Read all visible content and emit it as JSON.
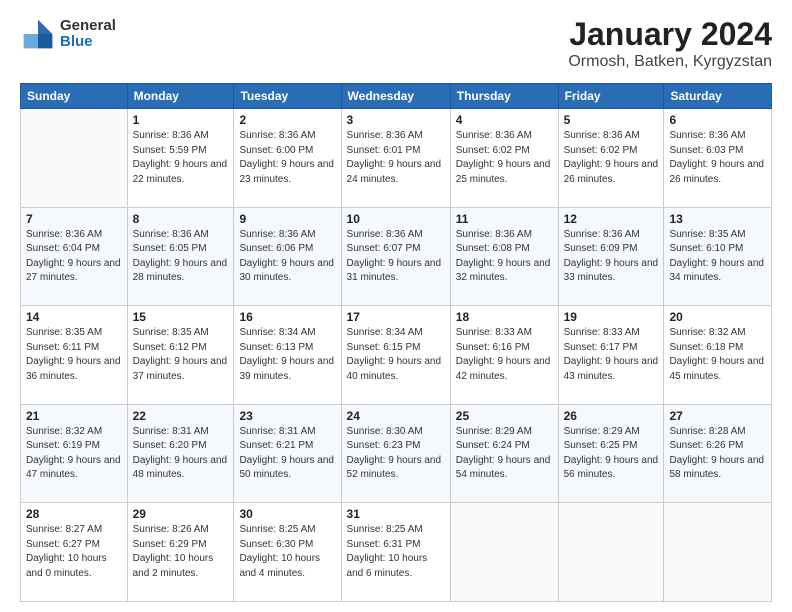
{
  "header": {
    "title": "January 2024",
    "location": "Ormosh, Batken, Kyrgyzstan",
    "logo_general": "General",
    "logo_blue": "Blue"
  },
  "days_of_week": [
    "Sunday",
    "Monday",
    "Tuesday",
    "Wednesday",
    "Thursday",
    "Friday",
    "Saturday"
  ],
  "weeks": [
    [
      {
        "day": "",
        "sunrise": "",
        "sunset": "",
        "daylight": "",
        "empty": true
      },
      {
        "day": "1",
        "sunrise": "Sunrise: 8:36 AM",
        "sunset": "Sunset: 5:59 PM",
        "daylight": "Daylight: 9 hours and 22 minutes."
      },
      {
        "day": "2",
        "sunrise": "Sunrise: 8:36 AM",
        "sunset": "Sunset: 6:00 PM",
        "daylight": "Daylight: 9 hours and 23 minutes."
      },
      {
        "day": "3",
        "sunrise": "Sunrise: 8:36 AM",
        "sunset": "Sunset: 6:01 PM",
        "daylight": "Daylight: 9 hours and 24 minutes."
      },
      {
        "day": "4",
        "sunrise": "Sunrise: 8:36 AM",
        "sunset": "Sunset: 6:02 PM",
        "daylight": "Daylight: 9 hours and 25 minutes."
      },
      {
        "day": "5",
        "sunrise": "Sunrise: 8:36 AM",
        "sunset": "Sunset: 6:02 PM",
        "daylight": "Daylight: 9 hours and 26 minutes."
      },
      {
        "day": "6",
        "sunrise": "Sunrise: 8:36 AM",
        "sunset": "Sunset: 6:03 PM",
        "daylight": "Daylight: 9 hours and 26 minutes."
      }
    ],
    [
      {
        "day": "7",
        "sunrise": "Sunrise: 8:36 AM",
        "sunset": "Sunset: 6:04 PM",
        "daylight": "Daylight: 9 hours and 27 minutes."
      },
      {
        "day": "8",
        "sunrise": "Sunrise: 8:36 AM",
        "sunset": "Sunset: 6:05 PM",
        "daylight": "Daylight: 9 hours and 28 minutes."
      },
      {
        "day": "9",
        "sunrise": "Sunrise: 8:36 AM",
        "sunset": "Sunset: 6:06 PM",
        "daylight": "Daylight: 9 hours and 30 minutes."
      },
      {
        "day": "10",
        "sunrise": "Sunrise: 8:36 AM",
        "sunset": "Sunset: 6:07 PM",
        "daylight": "Daylight: 9 hours and 31 minutes."
      },
      {
        "day": "11",
        "sunrise": "Sunrise: 8:36 AM",
        "sunset": "Sunset: 6:08 PM",
        "daylight": "Daylight: 9 hours and 32 minutes."
      },
      {
        "day": "12",
        "sunrise": "Sunrise: 8:36 AM",
        "sunset": "Sunset: 6:09 PM",
        "daylight": "Daylight: 9 hours and 33 minutes."
      },
      {
        "day": "13",
        "sunrise": "Sunrise: 8:35 AM",
        "sunset": "Sunset: 6:10 PM",
        "daylight": "Daylight: 9 hours and 34 minutes."
      }
    ],
    [
      {
        "day": "14",
        "sunrise": "Sunrise: 8:35 AM",
        "sunset": "Sunset: 6:11 PM",
        "daylight": "Daylight: 9 hours and 36 minutes."
      },
      {
        "day": "15",
        "sunrise": "Sunrise: 8:35 AM",
        "sunset": "Sunset: 6:12 PM",
        "daylight": "Daylight: 9 hours and 37 minutes."
      },
      {
        "day": "16",
        "sunrise": "Sunrise: 8:34 AM",
        "sunset": "Sunset: 6:13 PM",
        "daylight": "Daylight: 9 hours and 39 minutes."
      },
      {
        "day": "17",
        "sunrise": "Sunrise: 8:34 AM",
        "sunset": "Sunset: 6:15 PM",
        "daylight": "Daylight: 9 hours and 40 minutes."
      },
      {
        "day": "18",
        "sunrise": "Sunrise: 8:33 AM",
        "sunset": "Sunset: 6:16 PM",
        "daylight": "Daylight: 9 hours and 42 minutes."
      },
      {
        "day": "19",
        "sunrise": "Sunrise: 8:33 AM",
        "sunset": "Sunset: 6:17 PM",
        "daylight": "Daylight: 9 hours and 43 minutes."
      },
      {
        "day": "20",
        "sunrise": "Sunrise: 8:32 AM",
        "sunset": "Sunset: 6:18 PM",
        "daylight": "Daylight: 9 hours and 45 minutes."
      }
    ],
    [
      {
        "day": "21",
        "sunrise": "Sunrise: 8:32 AM",
        "sunset": "Sunset: 6:19 PM",
        "daylight": "Daylight: 9 hours and 47 minutes."
      },
      {
        "day": "22",
        "sunrise": "Sunrise: 8:31 AM",
        "sunset": "Sunset: 6:20 PM",
        "daylight": "Daylight: 9 hours and 48 minutes."
      },
      {
        "day": "23",
        "sunrise": "Sunrise: 8:31 AM",
        "sunset": "Sunset: 6:21 PM",
        "daylight": "Daylight: 9 hours and 50 minutes."
      },
      {
        "day": "24",
        "sunrise": "Sunrise: 8:30 AM",
        "sunset": "Sunset: 6:23 PM",
        "daylight": "Daylight: 9 hours and 52 minutes."
      },
      {
        "day": "25",
        "sunrise": "Sunrise: 8:29 AM",
        "sunset": "Sunset: 6:24 PM",
        "daylight": "Daylight: 9 hours and 54 minutes."
      },
      {
        "day": "26",
        "sunrise": "Sunrise: 8:29 AM",
        "sunset": "Sunset: 6:25 PM",
        "daylight": "Daylight: 9 hours and 56 minutes."
      },
      {
        "day": "27",
        "sunrise": "Sunrise: 8:28 AM",
        "sunset": "Sunset: 6:26 PM",
        "daylight": "Daylight: 9 hours and 58 minutes."
      }
    ],
    [
      {
        "day": "28",
        "sunrise": "Sunrise: 8:27 AM",
        "sunset": "Sunset: 6:27 PM",
        "daylight": "Daylight: 10 hours and 0 minutes."
      },
      {
        "day": "29",
        "sunrise": "Sunrise: 8:26 AM",
        "sunset": "Sunset: 6:29 PM",
        "daylight": "Daylight: 10 hours and 2 minutes."
      },
      {
        "day": "30",
        "sunrise": "Sunrise: 8:25 AM",
        "sunset": "Sunset: 6:30 PM",
        "daylight": "Daylight: 10 hours and 4 minutes."
      },
      {
        "day": "31",
        "sunrise": "Sunrise: 8:25 AM",
        "sunset": "Sunset: 6:31 PM",
        "daylight": "Daylight: 10 hours and 6 minutes."
      },
      {
        "day": "",
        "sunrise": "",
        "sunset": "",
        "daylight": "",
        "empty": true
      },
      {
        "day": "",
        "sunrise": "",
        "sunset": "",
        "daylight": "",
        "empty": true
      },
      {
        "day": "",
        "sunrise": "",
        "sunset": "",
        "daylight": "",
        "empty": true
      }
    ]
  ]
}
